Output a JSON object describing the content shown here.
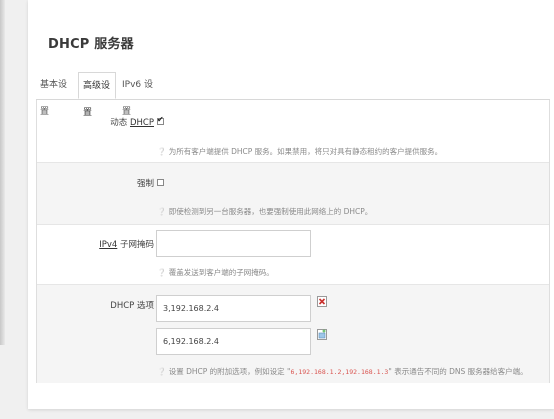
{
  "page": {
    "title": "DHCP 服务器"
  },
  "tabs": [
    {
      "label": "基本设置"
    },
    {
      "label": "高级设置",
      "active": true
    },
    {
      "label": "IPv6 设置"
    }
  ],
  "fields": {
    "dynamic_dhcp": {
      "label_prefix": "动态 ",
      "label_abbr": "DHCP",
      "checked": true,
      "hint": "为所有客户端提供 DHCP 服务。如果禁用，将只对具有静态租约的客户提供服务。"
    },
    "force": {
      "label": "强制",
      "checked": false,
      "hint": "即使检测到另一台服务器，也要强制使用此网络上的 DHCP。"
    },
    "ipv4_netmask": {
      "label_abbr": "IPv4",
      "label_suffix": " 子网掩码",
      "value": "",
      "hint": "覆盖发送到客户端的子网掩码。"
    },
    "dhcp_options": {
      "label": "DHCP 选项",
      "values": [
        "3,192.168.2.4",
        "6,192.168.2.4"
      ],
      "hint_before": "设置 DHCP 的附加选项，例如设定 \"",
      "hint_code": "6,192.168.1.2,192.168.1.3",
      "hint_after": "\" 表示通告不同的 DNS 服务器给客户端。"
    }
  },
  "icons": {
    "info": "info-icon",
    "remove": "remove-item-icon",
    "add": "add-item-icon"
  },
  "colors": {
    "hint_code": "#d9534f",
    "remove_icon": "#c9302c",
    "add_icon": "#5cb85c"
  }
}
